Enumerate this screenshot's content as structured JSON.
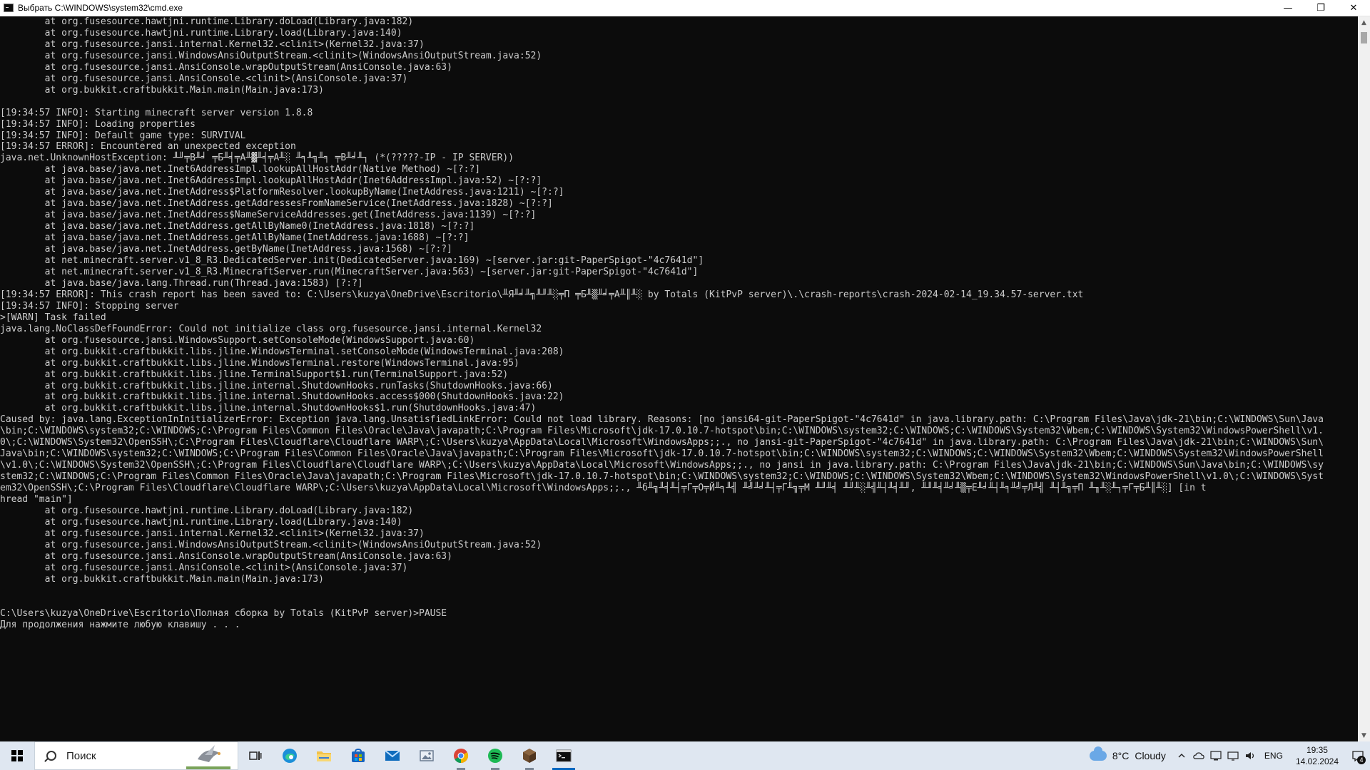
{
  "window": {
    "title": "Выбрать C:\\WINDOWS\\system32\\cmd.exe",
    "controls": {
      "minimize": "—",
      "maximize": "❐",
      "close": "✕"
    }
  },
  "console": {
    "lines": [
      "        at org.fusesource.hawtjni.runtime.Library.doLoad(Library.java:182)",
      "        at org.fusesource.hawtjni.runtime.Library.load(Library.java:140)",
      "        at org.fusesource.jansi.internal.Kernel32.<clinit>(Kernel32.java:37)",
      "        at org.fusesource.jansi.WindowsAnsiOutputStream.<clinit>(WindowsAnsiOutputStream.java:52)",
      "        at org.fusesource.jansi.AnsiConsole.wrapOutputStream(AnsiConsole.java:63)",
      "        at org.fusesource.jansi.AnsiConsole.<clinit>(AnsiConsole.java:37)",
      "        at org.bukkit.craftbukkit.Main.main(Main.java:173)",
      "",
      "[19:34:57 INFO]: Starting minecraft server version 1.8.8",
      "[19:34:57 INFO]: Loading properties",
      "[19:34:57 INFO]: Default game type: SURVIVAL",
      "[19:34:57 ERROR]: Encountered an unexpected exception",
      "java.net.UnknownHostException: ╨╜╤В╨╛ ╤Б╨╡╤А╨▓╨╡╤А╨░ ╨╕╨╗╨╕ ╤В╨╛╨┐ (*(?????-IP - IP SERVER))",
      "        at java.base/java.net.Inet6AddressImpl.lookupAllHostAddr(Native Method) ~[?:?]",
      "        at java.base/java.net.Inet6AddressImpl.lookupAllHostAddr(Inet6AddressImpl.java:52) ~[?:?]",
      "        at java.base/java.net.InetAddress$PlatformResolver.lookupByName(InetAddress.java:1211) ~[?:?]",
      "        at java.base/java.net.InetAddress.getAddressesFromNameService(InetAddress.java:1828) ~[?:?]",
      "        at java.base/java.net.InetAddress$NameServiceAddresses.get(InetAddress.java:1139) ~[?:?]",
      "        at java.base/java.net.InetAddress.getAllByName0(InetAddress.java:1818) ~[?:?]",
      "        at java.base/java.net.InetAddress.getAllByName(InetAddress.java:1688) ~[?:?]",
      "        at java.base/java.net.InetAddress.getByName(InetAddress.java:1568) ~[?:?]",
      "        at net.minecraft.server.v1_8_R3.DedicatedServer.init(DedicatedServer.java:169) ~[server.jar:git-PaperSpigot-\"4c7641d\"]",
      "        at net.minecraft.server.v1_8_R3.MinecraftServer.run(MinecraftServer.java:563) ~[server.jar:git-PaperSpigot-\"4c7641d\"]",
      "        at java.base/java.lang.Thread.run(Thread.java:1583) [?:?]",
      "[19:34:57 ERROR]: This crash report has been saved to: C:\\Users\\kuzya\\OneDrive\\Escritorio\\╨Я╨╛╨╗╨╜╨░╤П ╤Б╨▒╨╛╤А╨║╨░ by Totals (KitPvP server)\\.\\crash-reports\\crash-2024-02-14_19.34.57-server.txt",
      "[19:34:57 INFO]: Stopping server",
      ">[WARN] Task failed",
      "java.lang.NoClassDefFoundError: Could not initialize class org.fusesource.jansi.internal.Kernel32",
      "        at org.fusesource.jansi.WindowsSupport.setConsoleMode(WindowsSupport.java:60)",
      "        at org.bukkit.craftbukkit.libs.jline.WindowsTerminal.setConsoleMode(WindowsTerminal.java:208)",
      "        at org.bukkit.craftbukkit.libs.jline.WindowsTerminal.restore(WindowsTerminal.java:95)",
      "        at org.bukkit.craftbukkit.libs.jline.TerminalSupport$1.run(TerminalSupport.java:52)",
      "        at org.bukkit.craftbukkit.libs.jline.internal.ShutdownHooks.runTasks(ShutdownHooks.java:66)",
      "        at org.bukkit.craftbukkit.libs.jline.internal.ShutdownHooks.access$000(ShutdownHooks.java:22)",
      "        at org.bukkit.craftbukkit.libs.jline.internal.ShutdownHooks$1.run(ShutdownHooks.java:47)",
      "Caused by: java.lang.ExceptionInInitializerError: Exception java.lang.UnsatisfiedLinkError: Could not load library. Reasons: [no jansi64-git-PaperSpigot-\"4c7641d\" in java.library.path: C:\\Program Files\\Java\\jdk-21\\bin;C:\\WINDOWS\\Sun\\Java",
      "\\bin;C:\\WINDOWS\\system32;C:\\WINDOWS;C:\\Program Files\\Common Files\\Oracle\\Java\\javapath;C:\\Program Files\\Microsoft\\jdk-17.0.10.7-hotspot\\bin;C:\\WINDOWS\\system32;C:\\WINDOWS;C:\\WINDOWS\\System32\\Wbem;C:\\WINDOWS\\System32\\WindowsPowerShell\\v1.",
      "0\\;C:\\WINDOWS\\System32\\OpenSSH\\;C:\\Program Files\\Cloudflare\\Cloudflare WARP\\;C:\\Users\\kuzya\\AppData\\Local\\Microsoft\\WindowsApps;;., no jansi-git-PaperSpigot-\"4c7641d\" in java.library.path: C:\\Program Files\\Java\\jdk-21\\bin;C:\\WINDOWS\\Sun\\",
      "Java\\bin;C:\\WINDOWS\\system32;C:\\WINDOWS;C:\\Program Files\\Common Files\\Oracle\\Java\\javapath;C:\\Program Files\\Microsoft\\jdk-17.0.10.7-hotspot\\bin;C:\\WINDOWS\\system32;C:\\WINDOWS;C:\\WINDOWS\\System32\\Wbem;C:\\WINDOWS\\System32\\WindowsPowerShell",
      "\\v1.0\\;C:\\WINDOWS\\System32\\OpenSSH\\;C:\\Program Files\\Cloudflare\\Cloudflare WARP\\;C:\\Users\\kuzya\\AppData\\Local\\Microsoft\\WindowsApps;;., no jansi in java.library.path: C:\\Program Files\\Java\\jdk-21\\bin;C:\\WINDOWS\\Sun\\Java\\bin;C:\\WINDOWS\\sy",
      "stem32;C:\\WINDOWS;C:\\Program Files\\Common Files\\Oracle\\Java\\javapath;C:\\Program Files\\Microsoft\\jdk-17.0.10.7-hotspot\\bin;C:\\WINDOWS\\system32;C:\\WINDOWS;C:\\WINDOWS\\System32\\Wbem;C:\\WINDOWS\\System32\\WindowsPowerShell\\v1.0\\;C:\\WINDOWS\\Syst",
      "em32\\OpenSSH\\;C:\\Program Files\\Cloudflare\\Cloudflare WARP\\;C:\\Users\\kuzya\\AppData\\Local\\Microsoft\\WindowsApps;;., ╨б╨╗╨╡╨┤╤Г╤О╤Й╨╕╨╣ ╨╝╨╛╨┤╤Г╨╗╤М ╨╜╨╡ ╨╜╨░╨╣╨┤╨╡╨╜, ╨╜╨╡╨╛╨▒╤Е╨╛╨┤╨╕╨╝╤Л╨╣ ╨┤╨╗╤П ╨╖╨░╨┐╤Г╤Б╨║╨░] [in t",
      "hread \"main\"]",
      "        at org.fusesource.hawtjni.runtime.Library.doLoad(Library.java:182)",
      "        at org.fusesource.hawtjni.runtime.Library.load(Library.java:140)",
      "        at org.fusesource.jansi.internal.Kernel32.<clinit>(Kernel32.java:37)",
      "        at org.fusesource.jansi.WindowsAnsiOutputStream.<clinit>(WindowsAnsiOutputStream.java:52)",
      "        at org.fusesource.jansi.AnsiConsole.wrapOutputStream(AnsiConsole.java:63)",
      "        at org.fusesource.jansi.AnsiConsole.<clinit>(AnsiConsole.java:37)",
      "        at org.bukkit.craftbukkit.Main.main(Main.java:173)",
      "",
      "",
      "C:\\Users\\kuzya\\OneDrive\\Escritorio\\Полная сборка by Totals (KitPvP server)>PAUSE",
      "Для продолжения нажмите любую клавишу . . ."
    ]
  },
  "scrollbar": {
    "up": "▲",
    "down": "▼"
  },
  "taskbar": {
    "search_placeholder": "Поиск",
    "pinned": [
      {
        "name": "task-view",
        "icon": "task-view-icon"
      },
      {
        "name": "edge",
        "icon": "edge-icon"
      },
      {
        "name": "file-explorer",
        "icon": "folder-icon"
      },
      {
        "name": "microsoft-store",
        "icon": "store-icon"
      },
      {
        "name": "mail",
        "icon": "mail-icon"
      },
      {
        "name": "photos",
        "icon": "photos-icon"
      },
      {
        "name": "chrome",
        "icon": "chrome-icon"
      },
      {
        "name": "spotify",
        "icon": "spotify-icon"
      },
      {
        "name": "minecraft",
        "icon": "minecraft-icon"
      },
      {
        "name": "cmd",
        "icon": "terminal-icon"
      }
    ],
    "weather": {
      "temp": "8°C",
      "condition": "Cloudy"
    },
    "language": "ENG",
    "time": "19:35",
    "date": "14.02.2024",
    "notification_count": "4",
    "accent_color": "#0067c0"
  }
}
